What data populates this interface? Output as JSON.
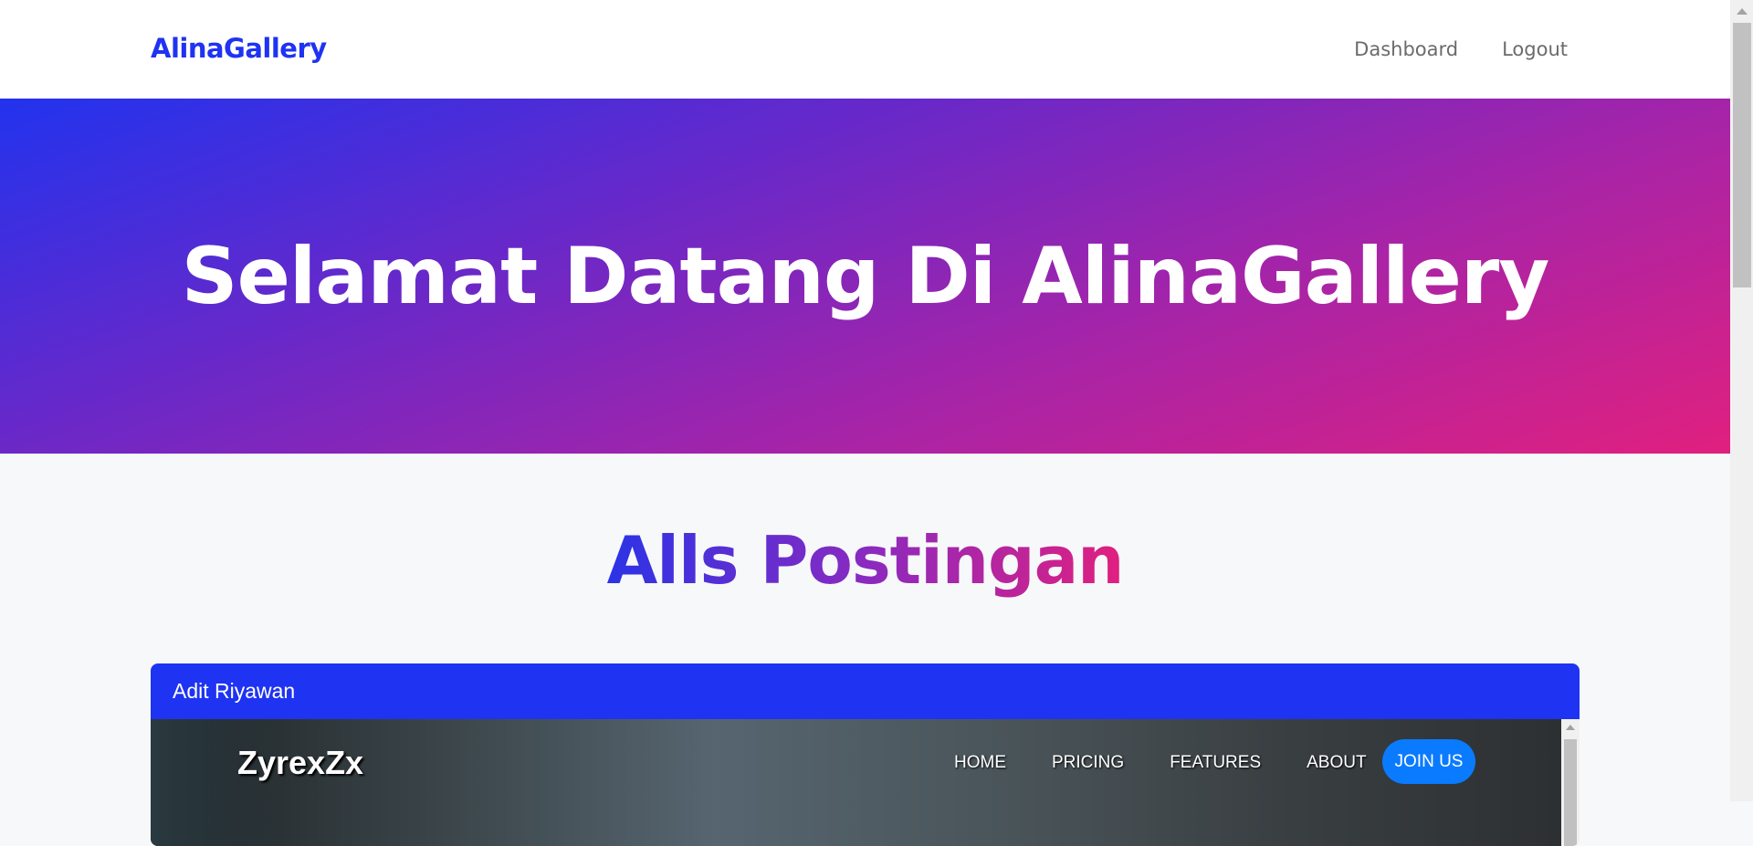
{
  "navbar": {
    "brand": "AlinaGallery",
    "links": [
      "Dashboard",
      "Logout"
    ]
  },
  "hero": {
    "title": "Selamat Datang Di AlinaGallery"
  },
  "section": {
    "title": "Alls Postingan"
  },
  "posts": [
    {
      "author": "Adit Riyawan",
      "preview": {
        "logo": "ZyrexZx",
        "menu": [
          "HOME",
          "PRICING",
          "FEATURES",
          "ABOUT"
        ],
        "cta": "JOIN US"
      }
    }
  ],
  "colors": {
    "brand": "#1f33f2",
    "gradient_start": "#2233ee",
    "gradient_end": "#e0207f",
    "cta": "#0a7bff"
  }
}
